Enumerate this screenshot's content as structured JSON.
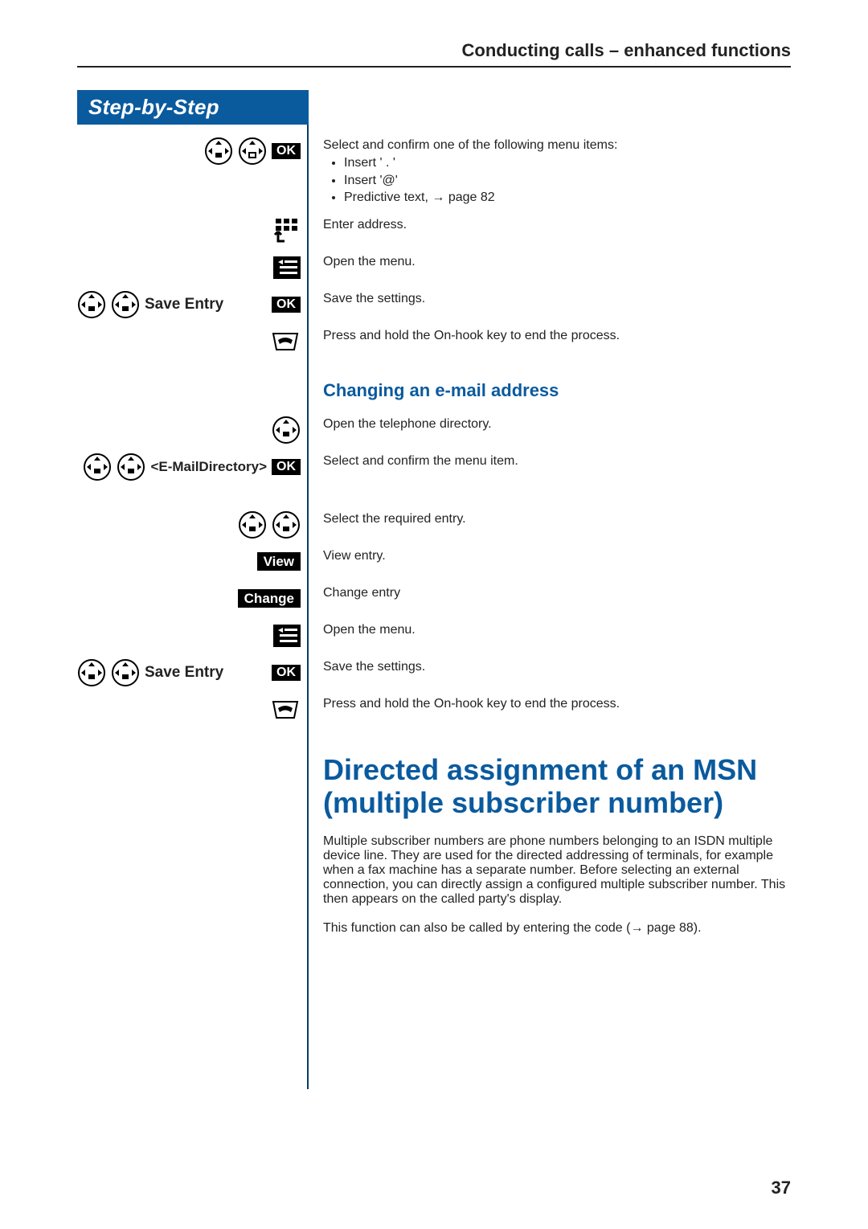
{
  "header": {
    "running": "Conducting calls – enhanced functions"
  },
  "sidebar": {
    "title": "Step-by-Step"
  },
  "softkeys": {
    "ok": "OK",
    "view": "View",
    "change": "Change"
  },
  "labels": {
    "save_entry": "Save Entry",
    "email_dir": "<E-MailDirectory>"
  },
  "steps": {
    "s1": {
      "intro": "Select and confirm one of the following menu items:",
      "items": [
        "Insert ' . '",
        "Insert '@'"
      ],
      "predictive_pre": "Predictive text, ",
      "predictive_arrow": "→",
      "predictive_post": " page 82"
    },
    "s2": "Enter address.",
    "s3": "Open the menu.",
    "s4": "Save the settings.",
    "s5": "Press and hold the On-hook key to end the process.",
    "subhead1": "Changing an e-mail address",
    "s6": "Open the telephone directory.",
    "s7": "Select and confirm the menu item.",
    "s8": "Select the required entry.",
    "s9": "View entry.",
    "s10": "Change entry",
    "s11": "Open the menu.",
    "s12": "Save the settings.",
    "s13": "Press and hold the On-hook key to end the process."
  },
  "section": {
    "title": "Directed assignment of an MSN (multiple subscriber number)",
    "p1": "Multiple subscriber numbers are phone numbers belonging to an ISDN multiple device line. They are used for the directed addressing of terminals, for example when a fax machine has a separate number. Before selecting an external connection, you can directly assign a configured multiple subscriber number. This then appears on the called party's display.",
    "p2_pre": "This function can also be called by entering the code (",
    "p2_arrow": "→",
    "p2_post": " page 88)."
  },
  "page_number": "37"
}
